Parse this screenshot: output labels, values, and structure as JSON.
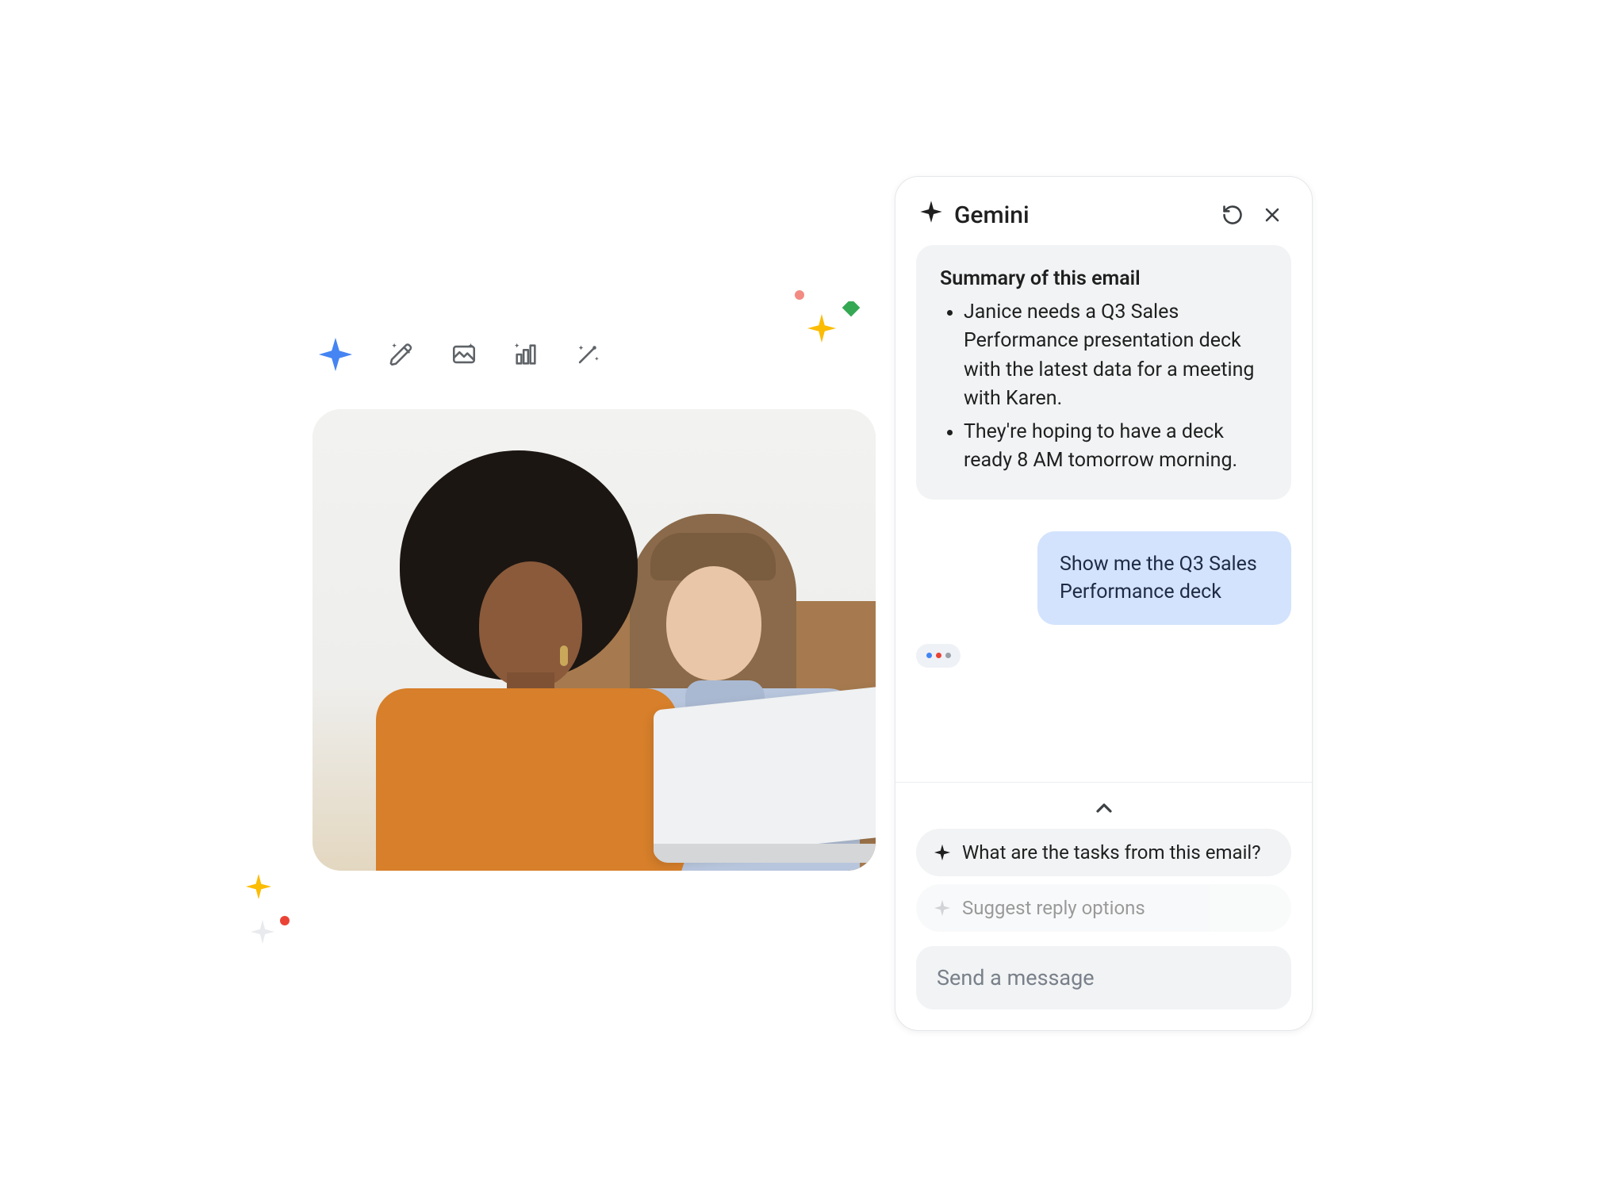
{
  "toolbar": {
    "tools": [
      {
        "name": "gradient-sparkle-icon"
      },
      {
        "name": "magic-pen-icon"
      },
      {
        "name": "magic-photo-icon"
      },
      {
        "name": "magic-chart-icon"
      },
      {
        "name": "magic-wand-icon"
      }
    ]
  },
  "panel": {
    "title": "Gemini",
    "summary_heading": "Summary of this email",
    "summary_items": [
      "Janice needs a Q3 Sales Performance presentation deck with the latest data for a meeting with Karen.",
      "They're hoping to have a deck ready 8 AM tomorrow morning."
    ],
    "user_message": "Show me the Q3 Sales Performance deck",
    "suggestions": [
      "What are the tasks from this email?",
      "Suggest reply options"
    ],
    "input_placeholder": "Send a message"
  }
}
